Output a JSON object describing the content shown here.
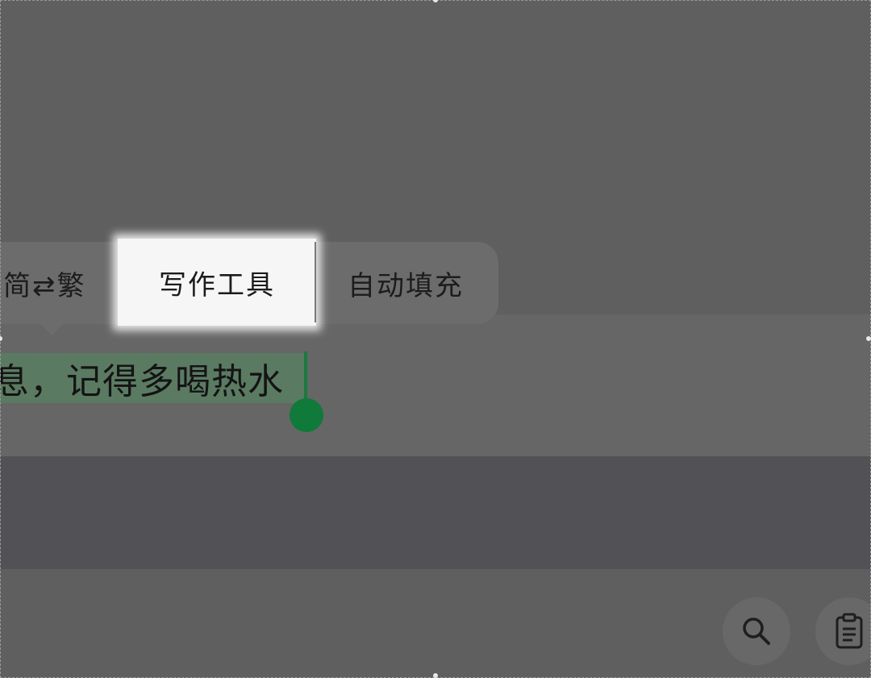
{
  "context_menu": {
    "items": [
      {
        "label": "简⇄繁"
      },
      {
        "label": "写作工具"
      },
      {
        "label": "自动填充"
      }
    ]
  },
  "input": {
    "text": "息，记得多喝热水"
  },
  "toolbar": {
    "buttons": [
      {
        "icon": "search-icon"
      },
      {
        "icon": "clipboard-icon"
      }
    ]
  },
  "colors": {
    "selection": "#5b7a62",
    "caret": "#0f7a3a",
    "highlight": "#f6f6f6"
  }
}
